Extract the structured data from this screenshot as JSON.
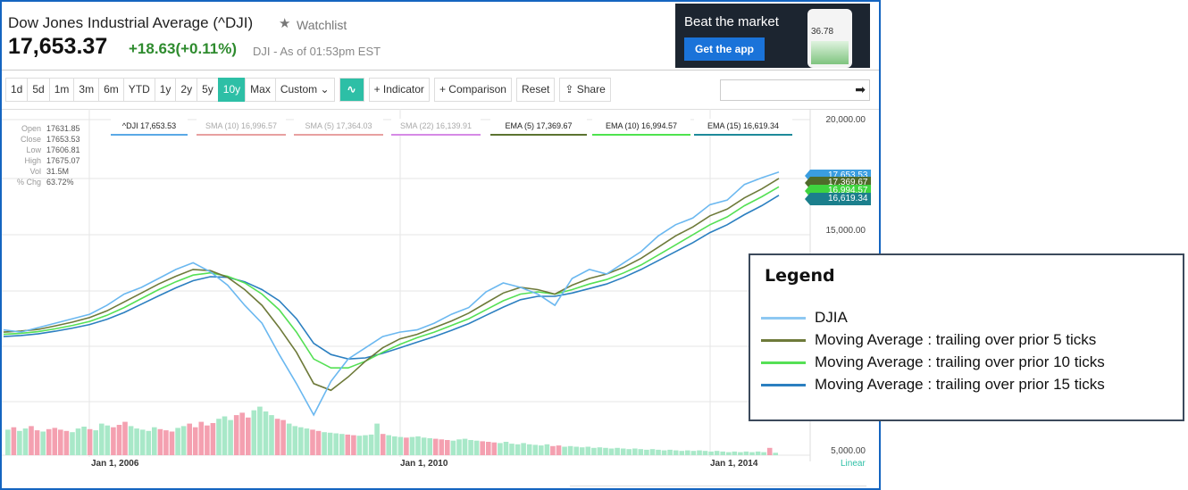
{
  "header": {
    "title": "Dow Jones Industrial Average (^DJI)",
    "watchlist_label": "Watchlist",
    "price": "17,653.37",
    "change": "+18.63(+0.11%)",
    "as_of": "DJI - As of 01:53pm EST"
  },
  "ad": {
    "headline": "Beat the market",
    "button": "Get the app",
    "phone_value": "36.78"
  },
  "toolbar": {
    "ranges": [
      "1d",
      "5d",
      "1m",
      "3m",
      "6m",
      "YTD",
      "1y",
      "2y",
      "5y",
      "10y",
      "Max"
    ],
    "active_range": "10y",
    "custom_label": "Custom ⌄",
    "indicator_label": "+ Indicator",
    "comparison_label": "+ Comparison",
    "reset_label": "Reset",
    "share_label": "Share",
    "search_go_icon": "arrow-right-icon"
  },
  "stats": [
    {
      "k": "Open",
      "v": "17631.85"
    },
    {
      "k": "Close",
      "v": "17653.53"
    },
    {
      "k": "Low",
      "v": "17606.81"
    },
    {
      "k": "High",
      "v": "17675.07"
    },
    {
      "k": "Vol",
      "v": "31.5M"
    },
    {
      "k": "% Chg",
      "v": "63.72%"
    }
  ],
  "chips": [
    {
      "label": "^DJI 17,653.53",
      "color": "#5aa9e6",
      "faded": false
    },
    {
      "label": "SMA (10) 16,996.57",
      "color": "#e8a0a0",
      "faded": true
    },
    {
      "label": "SMA (5) 17,364.03",
      "color": "#e8a0a0",
      "faded": true
    },
    {
      "label": "SMA (22) 16,139.91",
      "color": "#d68ae6",
      "faded": true
    },
    {
      "label": "EMA (5) 17,369.67",
      "color": "#5b7330",
      "faded": false
    },
    {
      "label": "EMA (10) 16,994.57",
      "color": "#4ee34e",
      "faded": false
    },
    {
      "label": "EMA (15) 16,619.34",
      "color": "#1d8a9a",
      "faded": false
    }
  ],
  "price_tags": [
    {
      "label": "17,653.53",
      "color": "#3a9de0"
    },
    {
      "label": "17,369.67",
      "color": "#4f6b2a"
    },
    {
      "label": "16,994.57",
      "color": "#3fd43f"
    },
    {
      "label": "16,619.34",
      "color": "#1b7f8c"
    }
  ],
  "chart_data": {
    "type": "line",
    "y_axis_labels": [
      "20,000.00",
      "15,000.00",
      "5,000.00"
    ],
    "x_axis_labels": [
      "Jan 1, 2006",
      "Jan 1, 2010",
      "Jan 1, 2014"
    ],
    "scale_label": "Linear",
    "ylim": [
      5000,
      20000
    ],
    "series": [
      {
        "name": "DJIA",
        "color": "#6bb8f0",
        "values": [
          10600,
          10500,
          10700,
          10900,
          11100,
          11300,
          11700,
          12200,
          12500,
          12900,
          13300,
          13600,
          13200,
          12600,
          11700,
          10900,
          9500,
          8200,
          6800,
          8300,
          9300,
          9800,
          10300,
          10500,
          10600,
          10900,
          11300,
          11600,
          12300,
          12700,
          12500,
          12200,
          11700,
          12900,
          13300,
          13100,
          13600,
          14100,
          14800,
          15300,
          15600,
          16200,
          16400,
          17100,
          17400,
          17653
        ]
      },
      {
        "name": "Moving Average : trailing over prior 5 ticks",
        "color": "#6e7a3a",
        "values": [
          10500,
          10550,
          10620,
          10780,
          10950,
          11150,
          11450,
          11850,
          12250,
          12650,
          13000,
          13300,
          13250,
          12950,
          12400,
          11700,
          10700,
          9600,
          8200,
          7900,
          8500,
          9200,
          9800,
          10200,
          10400,
          10700,
          11000,
          11350,
          11800,
          12250,
          12500,
          12400,
          12200,
          12600,
          12900,
          13100,
          13400,
          13800,
          14300,
          14800,
          15200,
          15700,
          16000,
          16500,
          16900,
          17370
        ]
      },
      {
        "name": "Moving Average : trailing over prior 10 ticks",
        "color": "#55e055",
        "values": [
          10400,
          10450,
          10520,
          10650,
          10800,
          10980,
          11250,
          11600,
          12000,
          12400,
          12750,
          13050,
          13150,
          13000,
          12700,
          12200,
          11500,
          10500,
          9300,
          8900,
          8900,
          9200,
          9600,
          9950,
          10250,
          10500,
          10800,
          11100,
          11500,
          11900,
          12200,
          12300,
          12200,
          12400,
          12650,
          12850,
          13150,
          13500,
          13950,
          14400,
          14850,
          15300,
          15650,
          16150,
          16550,
          16995
        ]
      },
      {
        "name": "Moving Average : trailing over prior 15 ticks",
        "color": "#2b7fc0",
        "values": [
          10300,
          10350,
          10420,
          10540,
          10680,
          10840,
          11070,
          11380,
          11750,
          12120,
          12480,
          12800,
          12980,
          12950,
          12750,
          12400,
          11900,
          11100,
          10000,
          9500,
          9300,
          9350,
          9550,
          9800,
          10050,
          10300,
          10580,
          10880,
          11250,
          11620,
          11950,
          12100,
          12100,
          12250,
          12450,
          12650,
          12950,
          13300,
          13700,
          14100,
          14500,
          14950,
          15300,
          15750,
          16150,
          16619
        ]
      }
    ],
    "volume": {
      "colors": {
        "up": "#a8e8c8",
        "down": "#f4a0b0"
      },
      "up_down": "uduuddudddduuuduuuddduuuuuddduuddddduuuddduuuudduuuudduuuudduuuuduuuduuuuddduuuuuddduuuuuuuuudduuuuuuuuuuuuuuuuuuuuuuuuuuuuuuuuuu",
      "levels": [
        0.42,
        0.46,
        0.4,
        0.44,
        0.48,
        0.41,
        0.39,
        0.43,
        0.45,
        0.42,
        0.4,
        0.38,
        0.44,
        0.47,
        0.43,
        0.41,
        0.52,
        0.49,
        0.46,
        0.5,
        0.55,
        0.48,
        0.44,
        0.42,
        0.4,
        0.46,
        0.43,
        0.41,
        0.39,
        0.45,
        0.48,
        0.52,
        0.46,
        0.55,
        0.49,
        0.53,
        0.6,
        0.64,
        0.58,
        0.66,
        0.7,
        0.62,
        0.74,
        0.8,
        0.72,
        0.66,
        0.6,
        0.58,
        0.52,
        0.48,
        0.46,
        0.44,
        0.42,
        0.4,
        0.38,
        0.37,
        0.36,
        0.35,
        0.34,
        0.33,
        0.32,
        0.33,
        0.34,
        0.52,
        0.35,
        0.33,
        0.31,
        0.3,
        0.29,
        0.3,
        0.31,
        0.29,
        0.28,
        0.27,
        0.26,
        0.25,
        0.24,
        0.26,
        0.27,
        0.25,
        0.24,
        0.23,
        0.22,
        0.21,
        0.2,
        0.22,
        0.19,
        0.18,
        0.2,
        0.18,
        0.17,
        0.16,
        0.18,
        0.15,
        0.16,
        0.14,
        0.15,
        0.14,
        0.13,
        0.14,
        0.12,
        0.13,
        0.12,
        0.11,
        0.12,
        0.11,
        0.1,
        0.11,
        0.1,
        0.09,
        0.1,
        0.09,
        0.08,
        0.09,
        0.08,
        0.07,
        0.08,
        0.07,
        0.08,
        0.07,
        0.06,
        0.07,
        0.06,
        0.05,
        0.06,
        0.05,
        0.06,
        0.05,
        0.06,
        0.05,
        0.12,
        0.04
      ]
    }
  },
  "legend": {
    "title": "Legend",
    "items": [
      {
        "label": "DJIA",
        "color": "#8ec8f2"
      },
      {
        "label": "Moving Average : trailing over prior 5 ticks",
        "color": "#6e7a3a"
      },
      {
        "label": "Moving Average : trailing over prior 10 ticks",
        "color": "#55e055"
      },
      {
        "label": "Moving Average : trailing over prior 15 ticks",
        "color": "#2b7fc0"
      }
    ]
  }
}
